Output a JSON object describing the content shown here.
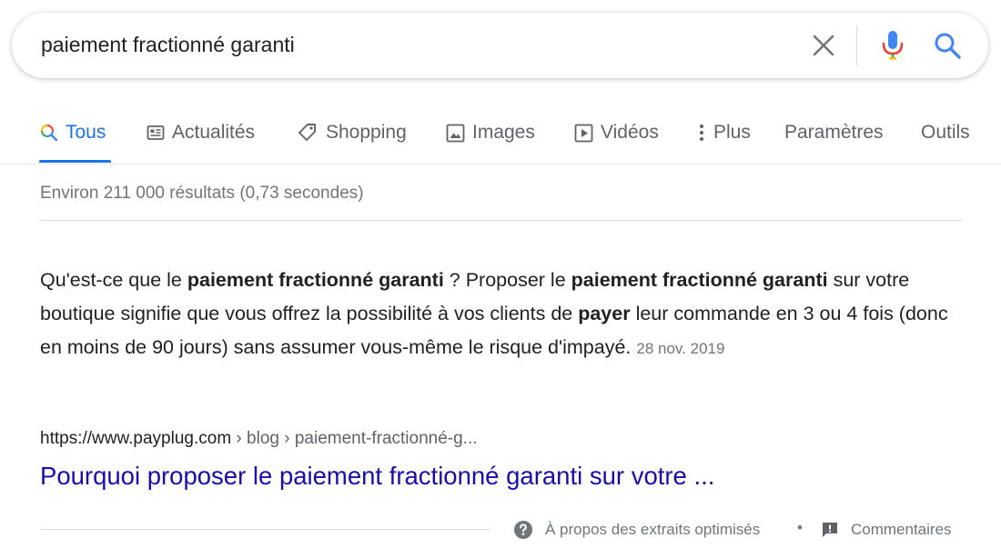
{
  "search": {
    "query": "paiement fractionné garanti"
  },
  "tabs": [
    {
      "label": "Tous",
      "icon": "search-icon",
      "active": true
    },
    {
      "label": "Actualités",
      "icon": "news-icon"
    },
    {
      "label": "Shopping",
      "icon": "tag-icon"
    },
    {
      "label": "Images",
      "icon": "image-icon"
    },
    {
      "label": "Vidéos",
      "icon": "play-icon"
    },
    {
      "label": "Plus",
      "icon": "more-vert-icon"
    },
    {
      "label": "Paramètres"
    },
    {
      "label": "Outils"
    }
  ],
  "stats": "Environ 211 000 résultats (0,73 secondes)",
  "snippet": {
    "p1": "Qu'est-ce que le ",
    "b1": "paiement fractionné garanti",
    "p2": " ? Proposer le ",
    "b2": "paiement fractionné garanti",
    "p3": " sur votre boutique signifie que vous offrez la possibilité à vos clients de ",
    "b3": "payer",
    "p4": " leur commande en 3 ou 4 fois (donc en moins de 90 jours) sans assumer vous-même le risque d'impayé.",
    "date": "28 nov. 2019"
  },
  "result": {
    "domain": "https://www.payplug.com",
    "path": " › blog › paiement-fractionné-g...",
    "title": "Pourquoi proposer le paiement fractionné garanti sur votre ..."
  },
  "footer": {
    "about": "À propos des extraits optimisés",
    "separator": "•",
    "feedback": "Commentaires"
  },
  "colors": {
    "link": "#1a0dab",
    "accent": "#1a73e8",
    "muted": "#70757a"
  }
}
